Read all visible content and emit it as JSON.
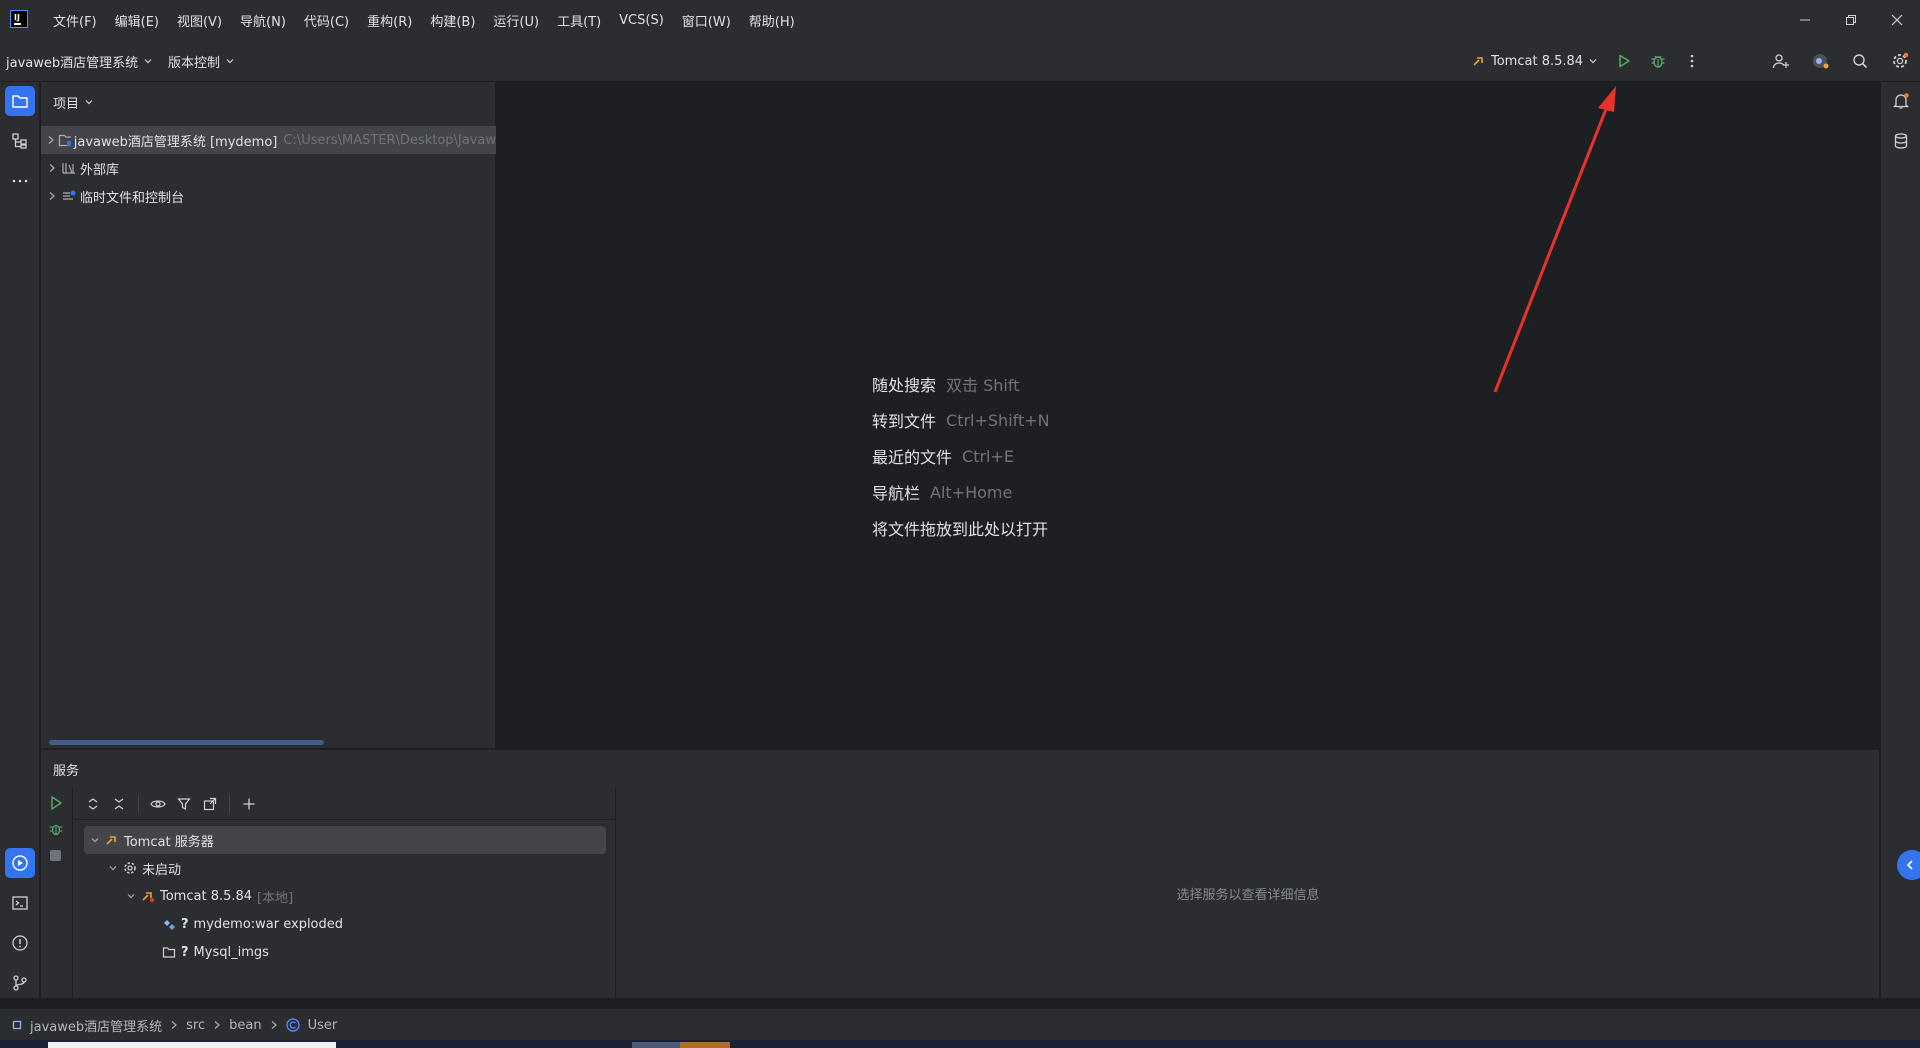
{
  "menu": [
    "文件(F)",
    "编辑(E)",
    "视图(V)",
    "导航(N)",
    "代码(C)",
    "重构(R)",
    "构建(B)",
    "运行(U)",
    "工具(T)",
    "VCS(S)",
    "窗口(W)",
    "帮助(H)"
  ],
  "toolbar": {
    "project_name": "javaweb酒店管理系统",
    "vcs_label": "版本控制",
    "run_config": "Tomcat 8.5.84"
  },
  "project_panel": {
    "title": "项目",
    "root_name": "javaweb酒店管理系统 [mydemo]",
    "root_path": "C:\\Users\\MASTER\\Desktop\\Javaw",
    "external_libs": "外部库",
    "scratches": "临时文件和控制台"
  },
  "editor_hints": [
    {
      "label": "随处搜索",
      "key": "双击 Shift"
    },
    {
      "label": "转到文件",
      "key": "Ctrl+Shift+N"
    },
    {
      "label": "最近的文件",
      "key": "Ctrl+E"
    },
    {
      "label": "导航栏",
      "key": "Alt+Home"
    },
    {
      "label": "将文件拖放到此处以打开",
      "key": ""
    }
  ],
  "services": {
    "title": "服务",
    "tree": {
      "root": "Tomcat 服务器",
      "not_started": "未启动",
      "server": "Tomcat 8.5.84",
      "server_tag": "[本地]",
      "artifact": "mydemo:war exploded",
      "folder": "Mysql_imgs",
      "unknown_mark": "?"
    },
    "detail_placeholder": "选择服务以查看详细信息"
  },
  "statusbar": {
    "breadcrumb": [
      "javaweb酒店管理系统",
      "src",
      "bean",
      "User"
    ]
  },
  "colors": {
    "accent": "#3574f0",
    "run_green": "#59a869",
    "annotation_red": "#e8322b"
  }
}
